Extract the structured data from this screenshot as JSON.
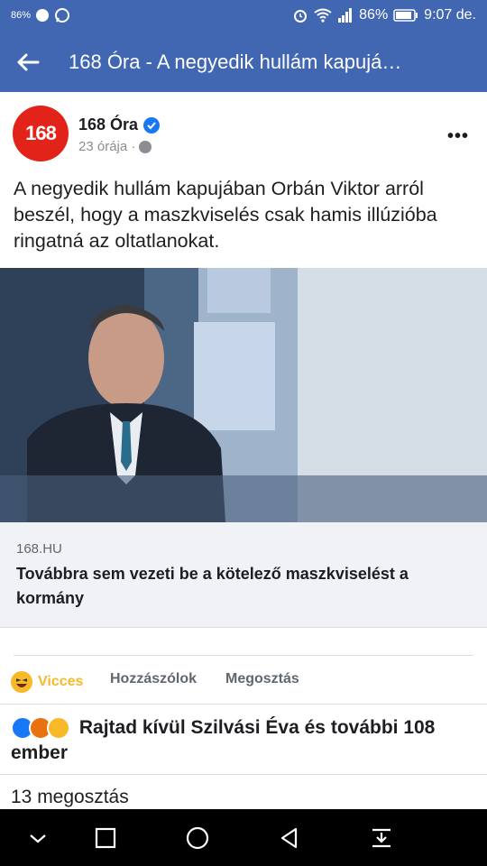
{
  "status_bar": {
    "left_text": "86%",
    "battery_pct": "86%",
    "time": "9:07 de."
  },
  "app_bar": {
    "title": "168 Óra - A negyedik hullám kapujá…"
  },
  "post": {
    "avatar_text": "168",
    "page_name": "168 Óra",
    "time": "23 órája ·",
    "text": "A negyedik hullám kapujában Orbán Viktor arról beszél, hogy a maszkviselés csak hamis illúzióba ringatná az oltatlanokat."
  },
  "link_preview": {
    "domain": "168.HU",
    "title": "Továbbra sem vezeti be a kötelező maszkviselést a kormány"
  },
  "actions": {
    "reaction_label": "Vicces",
    "comment_label": "Hozzászólok",
    "share_label": "Megosztás"
  },
  "reactions_summary": "Rajtad kívül Szilvási Éva és további 108 ember",
  "shares_text": "13 megosztás",
  "colors": {
    "facebook_blue": "#4267b2",
    "haha_yellow": "#f7b928",
    "avatar_red": "#e2231a"
  }
}
